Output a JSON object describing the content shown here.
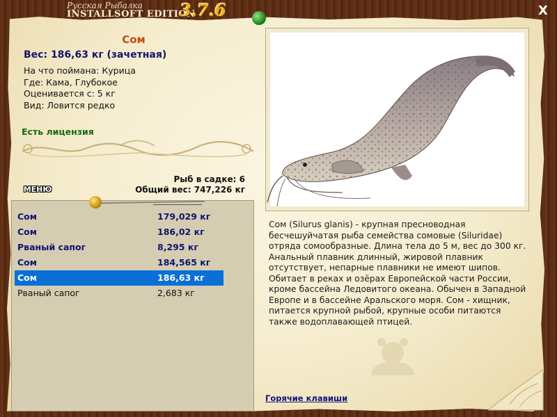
{
  "window": {
    "logo_line1": "Русская Рыбалка",
    "logo_line2": "INSTALLSOFT EDITION",
    "version": "3.7.6",
    "close_label": "X"
  },
  "fish": {
    "name": "Сом",
    "weight_line": "Вес: 186,63 кг (зачетная)",
    "caught_on": "На что поймана: Курица",
    "location": "Где: Кама, Глубокое",
    "scored_from": "Оценивается с: 5 кг",
    "kind": "Вид: Ловится редко",
    "license": "Есть лицензия"
  },
  "summary": {
    "fish_in_keepnet": "Рыб в садке: 6",
    "total_weight": "Общий вес: 747,226 кг"
  },
  "menu_label": "МЕНЮ",
  "catch_list": [
    {
      "name": "Сом",
      "weight": "179,029 кг",
      "style": "bold"
    },
    {
      "name": "Сом",
      "weight": "186,02 кг",
      "style": "bold"
    },
    {
      "name": "Рваный сапог",
      "weight": "8,295 кг",
      "style": "bold"
    },
    {
      "name": "Сом",
      "weight": "184,565 кг",
      "style": "bold"
    },
    {
      "name": "Сом",
      "weight": "186,63 кг",
      "style": "selected"
    },
    {
      "name": "Рваный сапог",
      "weight": "2,683 кг",
      "style": "plain"
    }
  ],
  "description": "Сом (Silurus glanis) - крупная пресноводная бесчешуйчатая рыба семейства сомовые (Siluridae) отряда сомообразные. Длина тела до 5 м, вес до 300 кг. Анальный плавник длинный, жировой плавник отсутствует, непарные плавники не имеют шипов. Обитает в реках и озёрах Европейской части России, кроме бассейна Ледовитого океана. Обычен в Западной Европе и в бассейне Аральского моря. Сом - хищник, питается крупной рыбой, крупные особи питаются также водоплавающей птицей.",
  "hotkeys_label": "Горячие клавиши",
  "colors": {
    "title": "#c24a10",
    "weight": "#12146a",
    "license": "#156a12",
    "selected_row": "#0a6fd6",
    "list_bg": "#d4cdb2"
  }
}
